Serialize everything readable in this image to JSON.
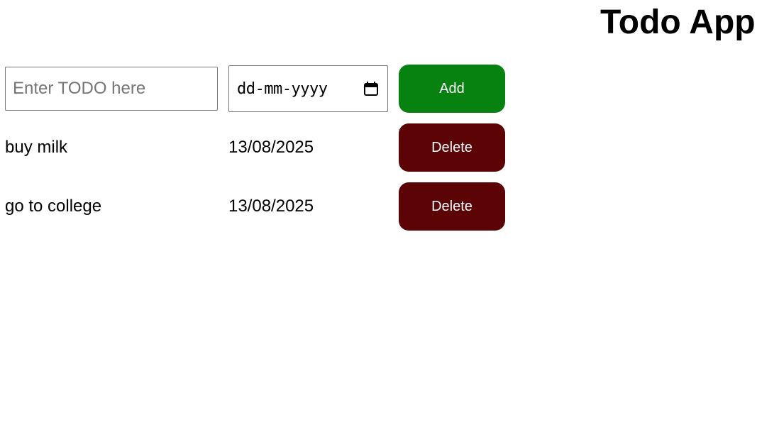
{
  "app": {
    "title": "Todo App"
  },
  "form": {
    "todo_placeholder": "Enter TODO here",
    "todo_value": "",
    "date_placeholder": "dd-mm-yyyy",
    "add_label": "Add",
    "calendar_icon": "calendar-icon"
  },
  "todos": [
    {
      "name": "buy milk",
      "date": "13/08/2025",
      "delete_label": "Delete"
    },
    {
      "name": "go to college",
      "date": "13/08/2025",
      "delete_label": "Delete"
    }
  ],
  "colors": {
    "add_button": "#078211",
    "delete_button": "#5c0305",
    "button_text": "#ffffff"
  }
}
